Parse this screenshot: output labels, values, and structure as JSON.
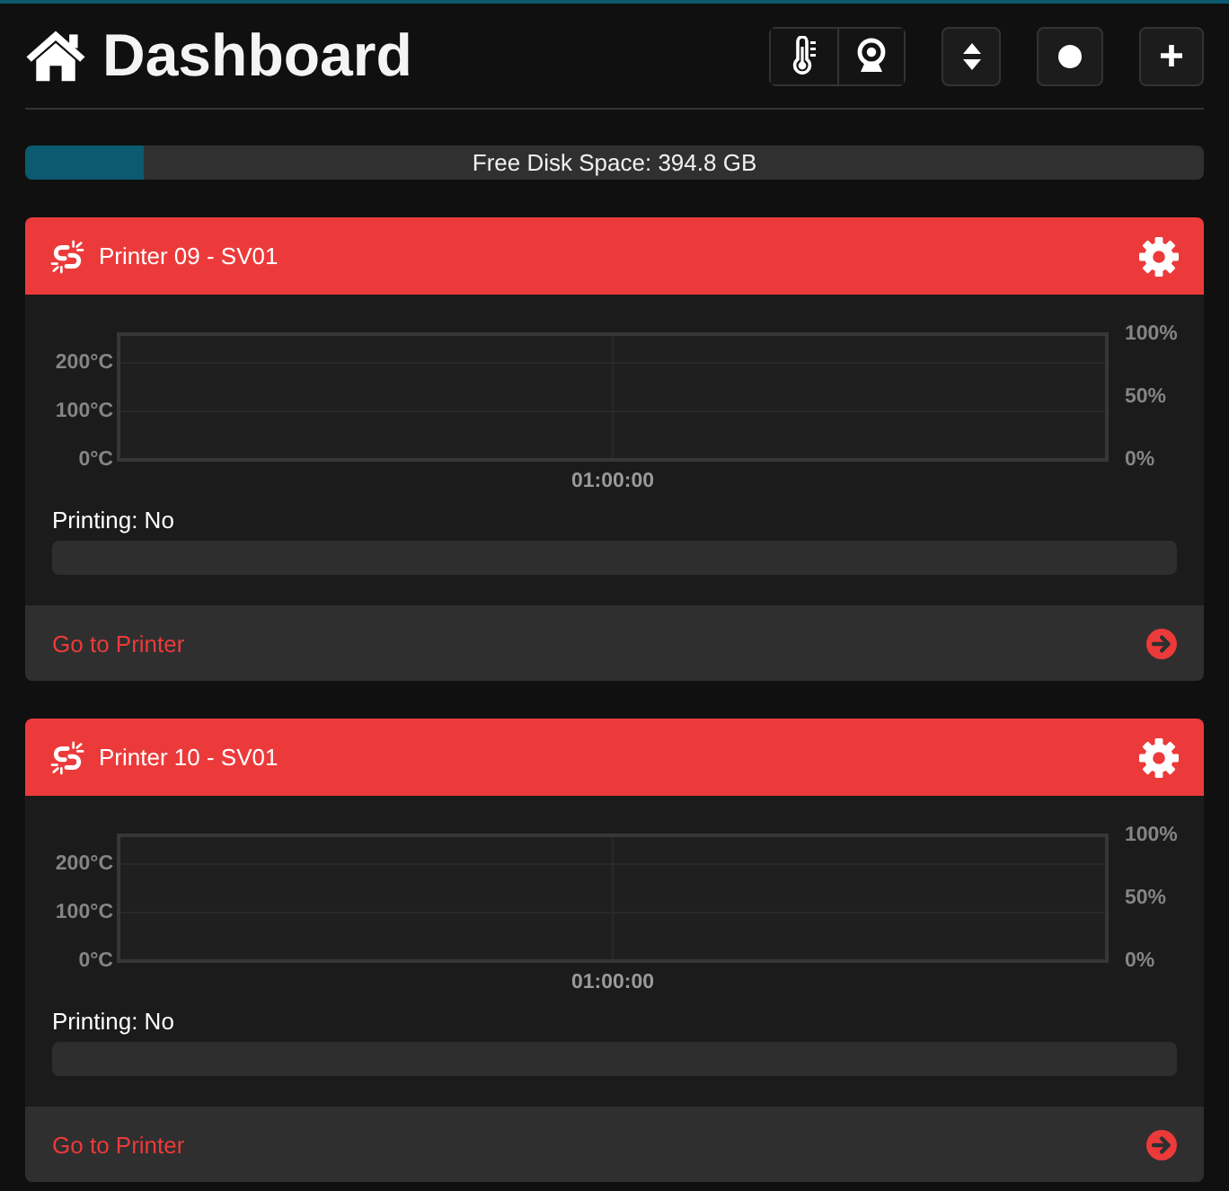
{
  "header": {
    "title": "Dashboard"
  },
  "disk": {
    "label": "Free Disk Space: 394.8 GB",
    "level": 0.1
  },
  "printers": [
    {
      "name": "Printer 09 - SV01",
      "chart": {
        "temperature_axis": [
          "200°C",
          "100°C",
          "0°C"
        ],
        "percent_axis": [
          "100%",
          "50%",
          "0%"
        ],
        "time_axis": [
          "01:00:00"
        ]
      },
      "status": "Printing: No",
      "link": "Go to Printer"
    },
    {
      "name": "Printer 10 - SV01",
      "chart": {
        "temperature_axis": [
          "200°C",
          "100°C",
          "0°C"
        ],
        "percent_axis": [
          "100%",
          "50%",
          "0%"
        ],
        "time_axis": [
          "01:00:00"
        ]
      },
      "status": "Printing: No",
      "link": "Go to Printer"
    }
  ]
}
